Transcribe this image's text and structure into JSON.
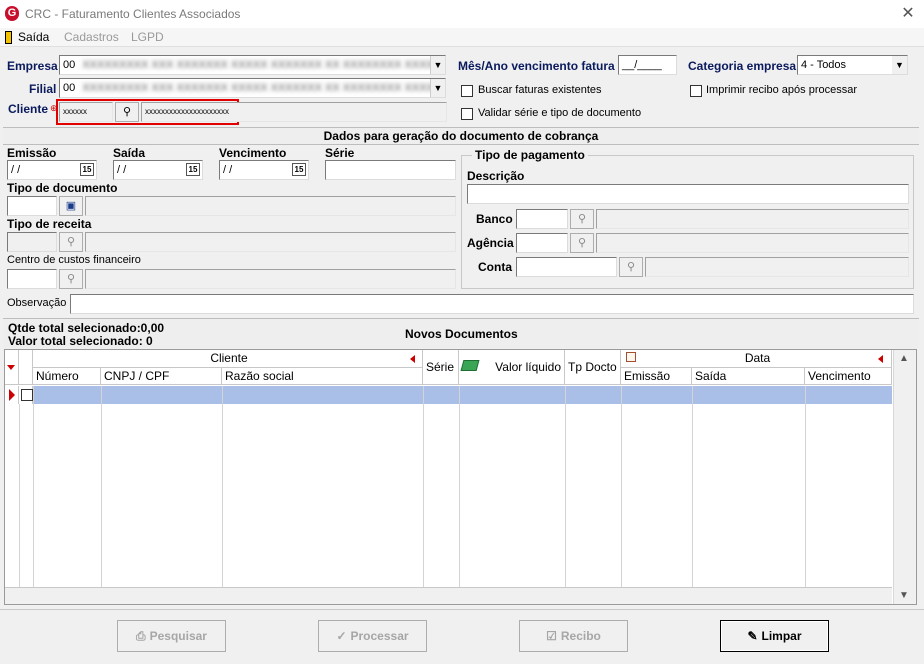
{
  "window": {
    "title": "CRC - Faturamento Clientes Associados",
    "logo_letter": "G"
  },
  "menu": {
    "items": [
      "Saída",
      "Cadastros",
      "LGPD"
    ]
  },
  "header": {
    "empresa_label": "Empresa",
    "empresa_value": "00",
    "empresa_blur": "XXXXXXXXX XXX XXXXXXX XXXXX XXXXXXX XX XXXXXXXX XXXXX",
    "filial_label": "Filial",
    "filial_value": "00",
    "filial_blur": "XXXXXXXXX XXX XXXXXXX XXXXX XXXXXXX XX XXXXXXXX XXXXX",
    "cliente_label": "Cliente",
    "cliente_code": "xxxxxx",
    "cliente_name": "xxxxxxxxxxxxxxxxxxxxx",
    "mes_ano_label": "Mês/Ano vencimento fatura",
    "mes_ano_value": "__/____",
    "categoria_label": "Categoria empresa",
    "categoria_value": "4 - Todos",
    "buscar_label": "Buscar faturas existentes",
    "validar_label": "Validar série e tipo de documento",
    "imprimir_label": "Imprimir recibo após processar"
  },
  "dados": {
    "section_title": "Dados para geração do documento de cobrança",
    "emissao_label": "Emissão",
    "emissao_value": " / /",
    "saida_label": "Saída",
    "saida_value": " / /",
    "vencimento_label": "Vencimento",
    "vencimento_value": " / /",
    "calendar_day": "15",
    "serie_label": "Série",
    "tipo_doc_label": "Tipo de documento",
    "tipo_receita_label": "Tipo de receita",
    "centro_label": "Centro de custos financeiro",
    "observacao_label": "Observação",
    "pagamento": {
      "group_label": "Tipo de pagamento",
      "descricao_label": "Descrição",
      "banco_label": "Banco",
      "agencia_label": "Agência",
      "conta_label": "Conta"
    }
  },
  "novos": {
    "title": "Novos Documentos",
    "qtde_label": "Qtde total selecionado:0,00",
    "valor_label": "Valor total selecionado: 0",
    "cliente_group": "Cliente",
    "data_group": "Data",
    "columns": [
      "Número",
      "CNPJ / CPF",
      "Razão social",
      "Série",
      "Valor líquido",
      "Tp Docto",
      "Emissão",
      "Saída",
      "Vencimento"
    ]
  },
  "buttons": {
    "pesquisar": "Pesquisar",
    "processar": "Processar",
    "recibo": "Recibo",
    "limpar": "Limpar"
  },
  "colors": {
    "highlight_row": "#a9bfe8",
    "required_border": "#e00000",
    "label_navy": "#0a1a5c"
  }
}
